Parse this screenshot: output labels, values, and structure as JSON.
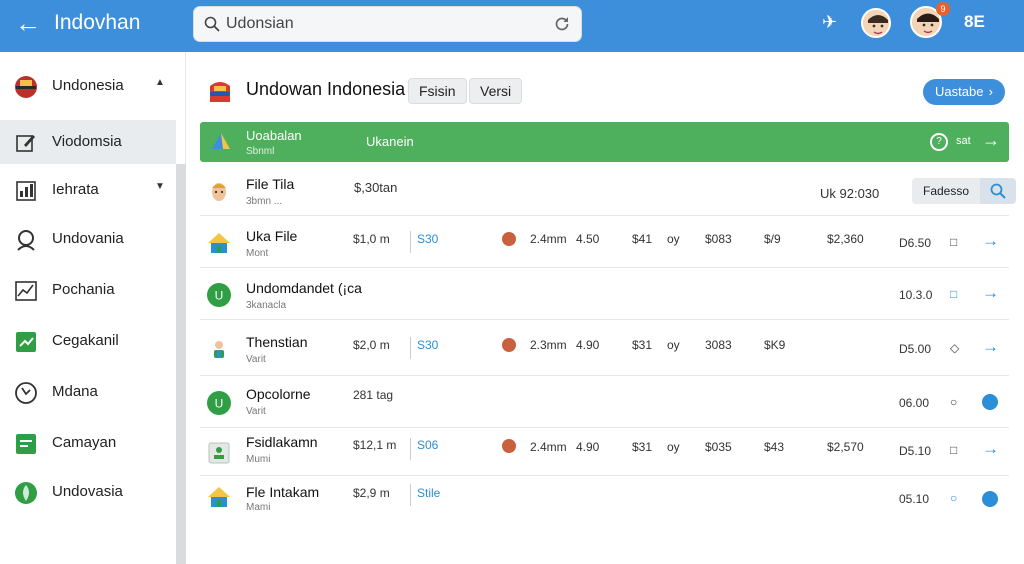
{
  "colors": {
    "topbar": "#3d8fdc",
    "green_bar": "#4eaf5c",
    "accent_blue": "#2a8fd6",
    "badge": "#e8612c"
  },
  "topbar": {
    "title": "Indovhan",
    "search_value": "Udonsian",
    "badge_count": "9",
    "icons": [
      "back-arrow-icon",
      "search-icon",
      "refresh-icon",
      "airplane-icon",
      "avatar",
      "grid-icon"
    ],
    "grid_label": "8E"
  },
  "sidebar": {
    "items": [
      {
        "label": "Undonesia",
        "icon": "flag-icon",
        "caret": "▲"
      },
      {
        "label": "Viodomsia",
        "icon": "edit-icon"
      },
      {
        "label": "Iehrata",
        "icon": "chart-icon",
        "caret": "▼"
      },
      {
        "label": "Undovania",
        "icon": "user-icon"
      },
      {
        "label": "Pochania",
        "icon": "graph-icon"
      },
      {
        "label": "Cegakanil",
        "icon": "check-icon"
      },
      {
        "label": "Mdana",
        "icon": "clock-icon"
      },
      {
        "label": "Camayan",
        "icon": "table-icon"
      },
      {
        "label": "Undovasia",
        "icon": "leaf-icon"
      }
    ]
  },
  "header": {
    "title": "Undowan Indonesia",
    "chip1": "Fsisin",
    "chip2": "Versi",
    "update_label": "Uastabe",
    "update_arrow": "›"
  },
  "green_bar": {
    "label": "Uoabalan",
    "sublabel": "Sbnml",
    "center_label": "Ukanein",
    "status_text": "sat",
    "arrow": "→"
  },
  "filter": {
    "name": "File Tila",
    "sub": "3bmn ...",
    "value": "$,30tan",
    "right_value": "Uk 92:030",
    "chip": "Fadesso"
  },
  "rows": [
    {
      "name": "Uka File",
      "sub": "Mont",
      "price": "$1,0 m",
      "tag": "S30",
      "face": true,
      "v1": "2.4mm",
      "v2": "4.50",
      "v3": "$41",
      "v4": "oy",
      "v5": "$083",
      "v6": "$/9",
      "v7": "$2,360",
      "time": "D6.50",
      "action": "square",
      "end": "arrow"
    },
    {
      "name": "Undomdandet (¡ca",
      "sub": "3kanacla",
      "price": "",
      "tag": "",
      "face": false,
      "v1": "",
      "v2": "",
      "v3": "",
      "v4": "",
      "v5": "",
      "v6": "",
      "v7": "",
      "time": "10.3.0",
      "action": "square-blue",
      "end": "arrow"
    },
    {
      "name": "Thenstian",
      "sub": "Varit",
      "price": "$2,0 m",
      "tag": "S30",
      "face": true,
      "v1": "2.3mm",
      "v2": "4.90",
      "v3": "$31",
      "v4": "oy",
      "v5": "3083",
      "v6": "$K9",
      "v7": "",
      "time": "D5.00",
      "action": "diamond",
      "end": "arrow"
    },
    {
      "name": "Opcolorne",
      "sub": "Varit",
      "price": "281 tag",
      "tag": "",
      "face": false,
      "v1": "",
      "v2": "",
      "v3": "",
      "v4": "",
      "v5": "",
      "v6": "",
      "v7": "",
      "time": "06.00",
      "action": "circle",
      "end": "dot"
    },
    {
      "name": "Fsidlakamn",
      "sub": "Mumi",
      "price": "$12,1 m",
      "tag": "S06",
      "face": true,
      "v1": "2.4mm",
      "v2": "4.90",
      "v3": "$31",
      "v4": "oy",
      "v5": "$035",
      "v6": "$43",
      "v7": "$2,570",
      "time": "D5.10",
      "action": "square",
      "end": "arrow"
    },
    {
      "name": "Fle Intakam",
      "sub": "Mami",
      "price": "$2,9 m",
      "tag": "Stile",
      "face": false,
      "v1": "",
      "v2": "",
      "v3": "",
      "v4": "",
      "v5": "",
      "v6": "",
      "v7": "",
      "time": "05.10",
      "action": "circle-blue",
      "end": "dot"
    }
  ]
}
